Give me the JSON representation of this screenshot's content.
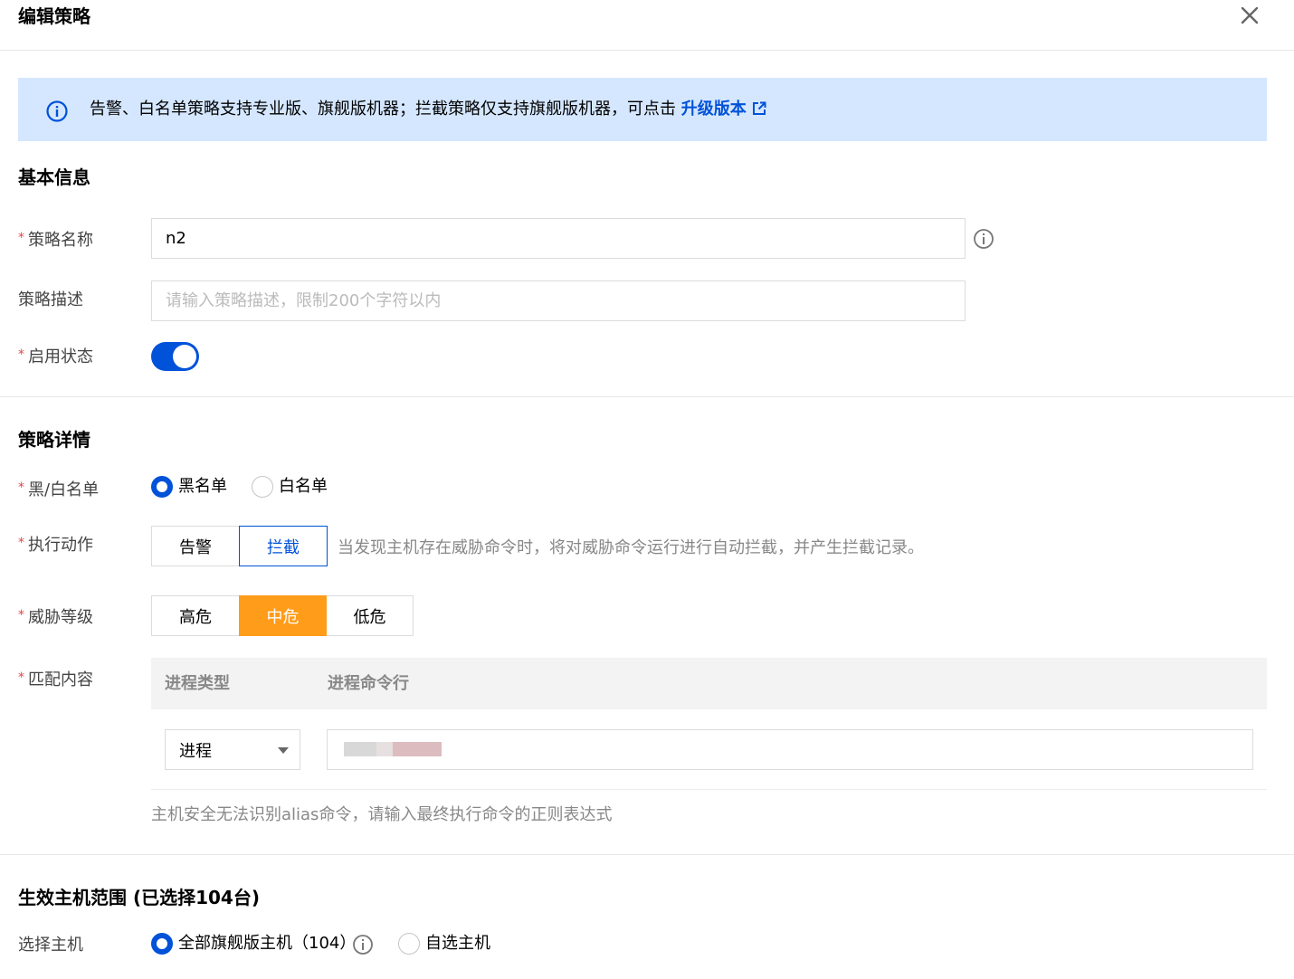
{
  "dialog": {
    "title": "编辑策略"
  },
  "notice": {
    "text": "告警、白名单策略支持专业版、旗舰版机器；拦截策略仅支持旗舰版机器，可点击",
    "link_label": "升级版本"
  },
  "basic_info": {
    "section_title": "基本信息",
    "name_label": "策略名称",
    "name_value": "n2",
    "desc_label": "策略描述",
    "desc_placeholder": "请输入策略描述，限制200个字符以内",
    "status_label": "启用状态",
    "status_enabled": true
  },
  "details": {
    "section_title": "策略详情",
    "list_label": "黑/白名单",
    "list_options": [
      "黑名单",
      "白名单"
    ],
    "list_selected": "黑名单",
    "action_label": "执行动作",
    "action_options": [
      "告警",
      "拦截"
    ],
    "action_selected": "拦截",
    "action_hint": "当发现主机存在威胁命令时，将对威胁命令运行进行自动拦截，并产生拦截记录。",
    "level_label": "威胁等级",
    "level_options": [
      "高危",
      "中危",
      "低危"
    ],
    "level_selected": "中危",
    "match_label": "匹配内容",
    "table_headers": [
      "进程类型",
      "进程命令行"
    ],
    "process_type_value": "进程",
    "match_hint": "主机安全无法识别alias命令，请输入最终执行命令的正则表达式"
  },
  "host_scope": {
    "section_title": "生效主机范围 (已选择104台)",
    "select_label": "选择主机",
    "options": [
      "全部旗舰版主机（104）",
      "自选主机"
    ],
    "selected": "全部旗舰版主机（104）"
  },
  "colors": {
    "primary": "#0052d9",
    "notice_bg": "#d5e7ff",
    "warning": "#ff9c19",
    "required": "#e54545"
  },
  "icons": {
    "close": "close-icon",
    "info": "info-circle-icon",
    "external_link": "external-link-icon",
    "caret": "caret-down-icon"
  }
}
